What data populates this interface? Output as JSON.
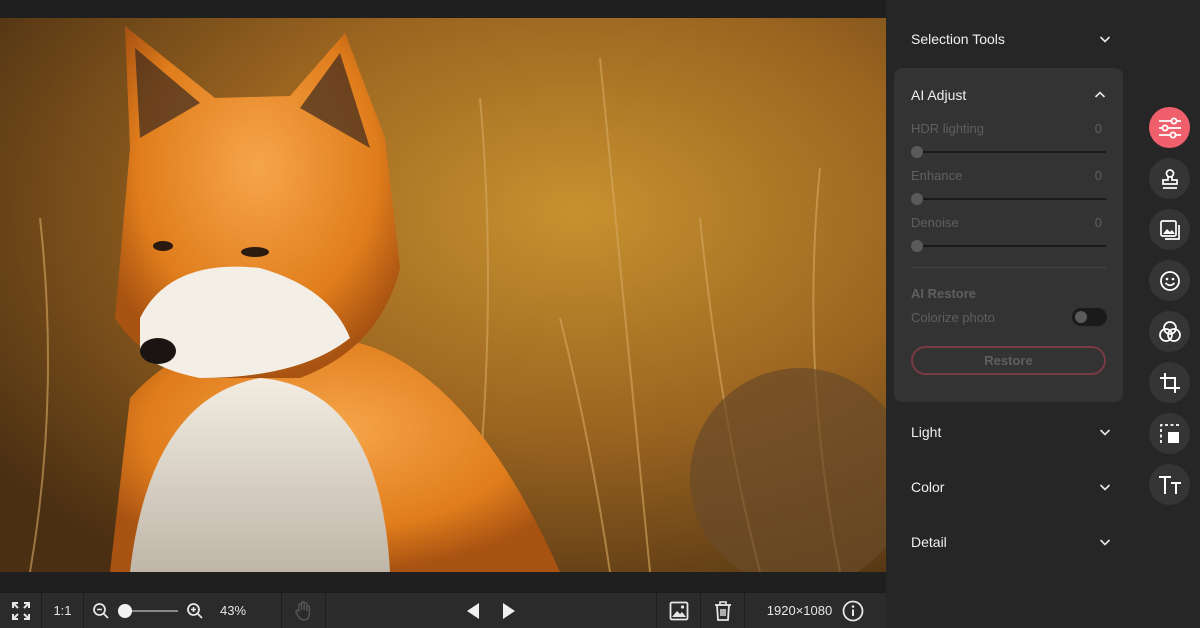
{
  "panel": {
    "selection_tools": "Selection Tools",
    "ai_adjust": {
      "title": "AI Adjust",
      "sliders": [
        {
          "label": "HDR lighting",
          "value": "0"
        },
        {
          "label": "Enhance",
          "value": "0"
        },
        {
          "label": "Denoise",
          "value": "0"
        }
      ],
      "restore_title": "AI Restore",
      "colorize_label": "Colorize photo",
      "colorize_on": false,
      "restore_button": "Restore"
    },
    "light": "Light",
    "color": "Color",
    "detail": "Detail"
  },
  "bottombar": {
    "one_to_one": "1:1",
    "zoom_percent": "43%",
    "zoom_level": 0.0,
    "dimensions": "1920×1080"
  },
  "rail": {
    "items": [
      {
        "icon": "adjust-sliders-icon",
        "active": true
      },
      {
        "icon": "stamp-icon",
        "active": false
      },
      {
        "icon": "image-icon",
        "active": false
      },
      {
        "icon": "smiley-icon",
        "active": false
      },
      {
        "icon": "color-circles-icon",
        "active": false
      },
      {
        "icon": "crop-icon",
        "active": false
      },
      {
        "icon": "selection-icon",
        "active": false
      },
      {
        "icon": "text-icon",
        "active": false
      }
    ]
  },
  "colors": {
    "accent": "#ef5f6c",
    "panel_bg": "#262626",
    "card_bg": "#333333"
  }
}
